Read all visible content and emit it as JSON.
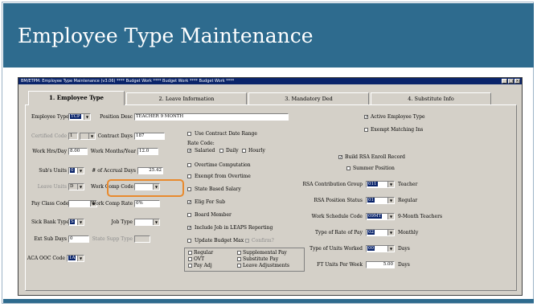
{
  "slide": {
    "title": "Employee Type Maintenance",
    "accent_color": "#2e6b8e",
    "highlight_color": "#e88a2e"
  },
  "window": {
    "title": "BM/ETPM: Employee Type Maintenance (v3.06) **** Budget Work **** Budget Work **** Budget Work ****",
    "min_icon": "minimize-icon",
    "max_icon": "maximize-icon",
    "close_icon": "close-icon"
  },
  "tabs": [
    {
      "label": "1. Employee Type",
      "active": true
    },
    {
      "label": "2. Leave Information",
      "active": false
    },
    {
      "label": "3. Mandatory Ded",
      "active": false
    },
    {
      "label": "4. Substitute Info",
      "active": false
    }
  ],
  "left": {
    "employee_type_label": "Employee Type",
    "employee_type_value": "TCP",
    "position_desc_label": "Position Desc",
    "position_desc_value": "TEACHER 9 MONTH",
    "certified_code_label": "Certified Code",
    "certified_code_value": "1",
    "contract_days_label": "Contract Days",
    "contract_days_value": "187",
    "work_hrs_label": "Work Hrs/Day",
    "work_hrs_value": "8.00",
    "work_months_label": "Work Months/Year",
    "work_months_value": "12.0",
    "subs_units_label": "Sub's Units",
    "subs_units_value": "0",
    "accrual_days_label": "# of Accrual Days",
    "accrual_days_value": "25.42",
    "leave_units_label": "Leave Units",
    "leave_units_value": "D",
    "work_comp_code_label": "Work Comp Code",
    "work_comp_code_value": "",
    "pay_class_label": "Pay Class Code",
    "pay_class_value": "",
    "work_comp_rate_label": "Work Comp Rate",
    "work_comp_rate_value": "0%",
    "sick_bank_label": "Sick Bank Type",
    "sick_bank_value": "S",
    "job_type_label": "Job Type",
    "job_type_value": "",
    "ext_sub_days_label": "Ext Sub Days",
    "ext_sub_days_value": "0",
    "state_supp_label": "State Supp Type",
    "state_supp_value": "",
    "aca_ooc_label": "ACA OOC Code",
    "aca_ooc_value": "1A"
  },
  "middle": {
    "use_contract_date_range": "Use Contract Date Range",
    "rate_code_label": "Rate Code:",
    "salaried": "Salaried",
    "daily": "Daily",
    "hourly": "Hourly",
    "overtime_computation": "Overtime Computation",
    "exempt_from_overtime": "Exempt from Overtime",
    "state_based_salary": "State Based Salary",
    "elig_for_sub": "Elig For Sub",
    "board_member": "Board Member",
    "include_job_leaps": "Include Job in LEAPS Reporting",
    "update_budget_max": "Update Budget Max",
    "confirm": "Confirm?",
    "regular": "Regular",
    "ovt": "OVT",
    "pay_adj": "Pay Adj",
    "supplemental_pay": "Supplemental Pay",
    "substitute_pay": "Substitute Pay",
    "leave_adjustments": "Leave Adjustments"
  },
  "right": {
    "active_employee_type": "Active Employee Type",
    "exempt_matching_ins": "Exempt Matching Ins",
    "build_rsa_enroll": "Build RSA Enroll Record",
    "summer_position": "Summer Position",
    "rsa_group_label": "RSA Contribution Group",
    "rsa_group_value": "011",
    "rsa_group_desc": "Teacher",
    "rsa_status_label": "RSA Position Status",
    "rsa_status_value": "01",
    "rsa_status_desc": "Regular",
    "work_schedule_label": "Work Schedule Code",
    "work_schedule_value": "09MT",
    "work_schedule_desc": "9-Month Teachers",
    "type_rate_label": "Type of Rate of Pay",
    "type_rate_value": "02",
    "type_rate_desc": "Monthly",
    "type_units_label": "Type of Units Worked",
    "type_units_value": "00",
    "type_units_desc": "Days",
    "fte_label": "FT Units Per Week",
    "fte_value": "5.00",
    "fte_desc": "Days"
  }
}
